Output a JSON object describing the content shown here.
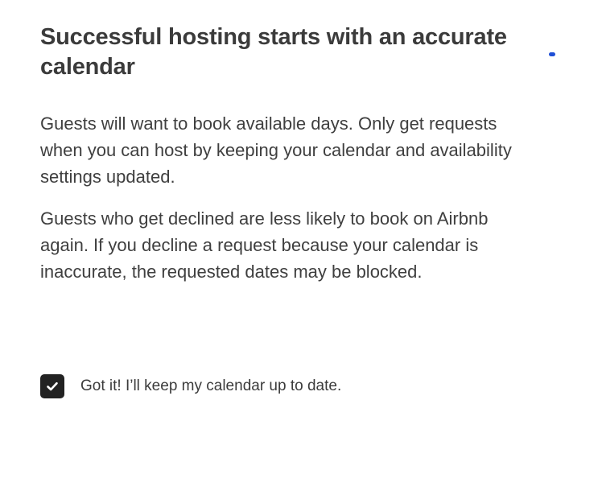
{
  "modal": {
    "title": "Successful hosting starts with an accurate calendar",
    "paragraphs": [
      "Guests will want to book available days. Only get requests when you can host by keeping your calendar and availability settings updated.",
      "Guests who get declined are less likely to book on Airbnb again. If you decline a request because your calendar is inaccurate, the requested dates may be blocked."
    ],
    "agreement": {
      "label": "Got it! I’ll keep my calendar up to date.",
      "checked": true
    },
    "colors": {
      "checkbox_fill": "#222222",
      "loader_accent": "#1f4fd6"
    },
    "icons": {
      "checkbox": "checkmark-icon",
      "loader": "loading-indicator-icon"
    }
  }
}
